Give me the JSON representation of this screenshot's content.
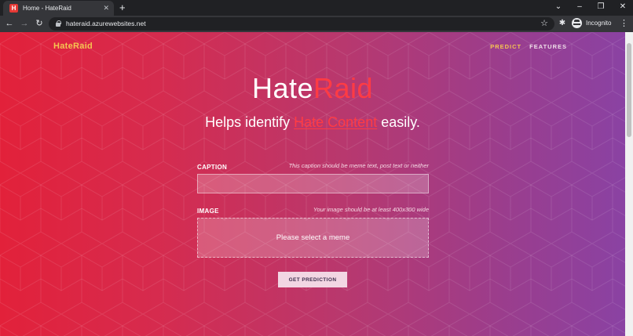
{
  "browser": {
    "tab_title": "Home - HateRaid",
    "favicon_letter": "H",
    "url": "hateraid.azurewebsites.net",
    "incognito_label": "Incognito"
  },
  "navbar": {
    "brand": "HateRaid",
    "links": [
      "PREDICT",
      "FEATURES"
    ],
    "active_link": "PREDICT"
  },
  "hero": {
    "title_main": "Hate",
    "title_accent": "Raid",
    "subtitle_before": "Helps identify ",
    "subtitle_highlight": "Hate Content",
    "subtitle_after": " easily."
  },
  "form": {
    "caption_label": "CAPTION",
    "caption_hint": "This caption should be meme text, post text or neither",
    "caption_value": "",
    "image_label": "IMAGE",
    "image_hint": "Your image should be at least 400x300 wide",
    "dropzone_text": "Please select a meme",
    "submit_label": "GET PREDICTION"
  },
  "colors": {
    "gradient_start": "#e2213a",
    "gradient_end": "#8a42a3",
    "brand_yellow": "#f5c451",
    "accent_red": "#ff3b44"
  },
  "icons": [
    "back-icon",
    "forward-icon",
    "reload-icon",
    "lock-icon",
    "star-icon",
    "extensions-icon",
    "incognito-icon",
    "menu-icon",
    "new-tab-icon",
    "close-icon",
    "minimize-icon",
    "maximize-icon",
    "chevron-down-icon"
  ]
}
